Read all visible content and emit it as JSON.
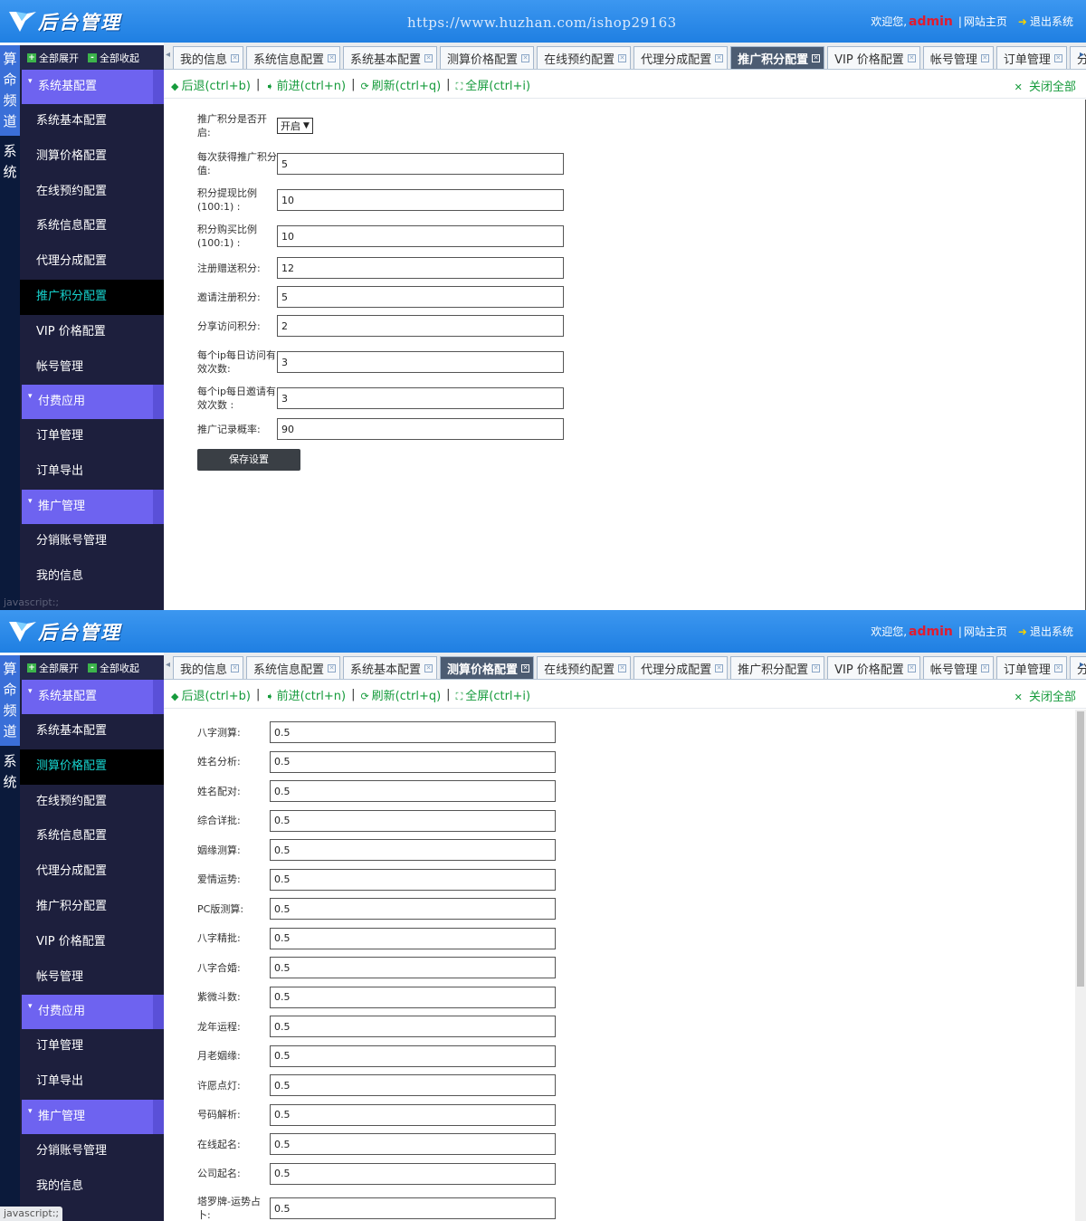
{
  "brand": {
    "title": "后台管理",
    "watermark": "https://www.huzhan.com/ishop29163"
  },
  "user": {
    "welcome": "欢迎您,",
    "name": "admin",
    "sep": "|",
    "site_link": "网站主页",
    "logout": "退出系统"
  },
  "channels": {
    "active": "算命频道",
    "system": "系统"
  },
  "sidebar_top": {
    "expand_all": "全部展开",
    "collapse_all": "全部收起"
  },
  "sidebar": {
    "group1": "系统基配置",
    "group1_items": [
      "系统基本配置",
      "测算价格配置",
      "在线预约配置",
      "系统信息配置",
      "代理分成配置",
      "推广积分配置",
      "VIP 价格配置",
      "帐号管理"
    ],
    "group2": "付费应用",
    "group2_items": [
      "订单管理",
      "订单导出"
    ],
    "group3": "推广管理",
    "group3_items": [
      "分销账号管理",
      "我的信息"
    ]
  },
  "tabs": [
    "我的信息",
    "系统信息配置",
    "系统基本配置",
    "测算价格配置",
    "在线预约配置",
    "代理分成配置",
    "推广积分配置",
    "VIP 价格配置",
    "帐号管理",
    "订单管理",
    "分销账号管理"
  ],
  "navbar": {
    "back": "后退(ctrl+b)",
    "forward": "前进(ctrl+n)",
    "refresh": "刷新(ctrl+q)",
    "fullscreen": "全屏(ctrl+i)",
    "close_all": "关闭全部"
  },
  "status_text": "javascript:;",
  "pane1": {
    "active_tab": "推广积分配置",
    "fields": [
      {
        "label": "推广积分是否开启:",
        "type": "select",
        "value": "开启"
      },
      {
        "label": "每次获得推广积分值:",
        "value": "5"
      },
      {
        "label": "积分提现比例 (100:1) :",
        "value": "10"
      },
      {
        "label": "积分购买比例 (100:1) :",
        "value": "10"
      },
      {
        "label": "注册赠送积分:",
        "value": "12"
      },
      {
        "label": "邀请注册积分:",
        "value": "5"
      },
      {
        "label": "分享访问积分:",
        "value": "2"
      },
      {
        "label": "每个ip每日访问有效次数:",
        "value": "3"
      },
      {
        "label": "每个ip每日邀请有效次数 :",
        "value": "3"
      },
      {
        "label": "推广记录概率:",
        "value": "90"
      }
    ],
    "save_label": "保存设置"
  },
  "pane2": {
    "active_tab": "测算价格配置",
    "fields": [
      {
        "label": "八字测算:",
        "value": "0.5"
      },
      {
        "label": "姓名分析:",
        "value": "0.5"
      },
      {
        "label": "姓名配对:",
        "value": "0.5"
      },
      {
        "label": "综合详批:",
        "value": "0.5"
      },
      {
        "label": "姻缘测算:",
        "value": "0.5"
      },
      {
        "label": "爱情运势:",
        "value": "0.5"
      },
      {
        "label": "PC版测算:",
        "value": "0.5"
      },
      {
        "label": "八字精批:",
        "value": "0.5"
      },
      {
        "label": "八字合婚:",
        "value": "0.5"
      },
      {
        "label": "紫微斗数:",
        "value": "0.5"
      },
      {
        "label": "龙年运程:",
        "value": "0.5"
      },
      {
        "label": "月老姻缘:",
        "value": "0.5"
      },
      {
        "label": "许愿点灯:",
        "value": "0.5"
      },
      {
        "label": "号码解析:",
        "value": "0.5"
      },
      {
        "label": "在线起名:",
        "value": "0.5"
      },
      {
        "label": "公司起名:",
        "value": "0.5"
      },
      {
        "label": "塔罗牌-运势占卜:",
        "value": "0.5"
      }
    ]
  },
  "colors": {
    "header": "#2a8bea",
    "sidebar": "#1d1f3d",
    "group": "#6e63f0",
    "active_item_text": "#17d4cf",
    "accent_green": "#169b3c",
    "admin_red": "#e21b2e"
  }
}
